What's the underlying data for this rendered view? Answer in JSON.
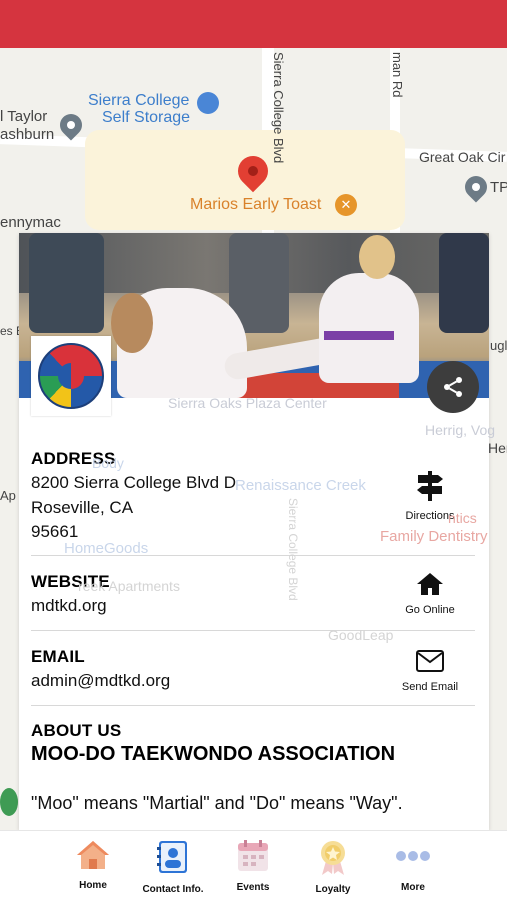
{
  "map": {
    "labels": {
      "taylor": "l Taylor",
      "ashburn": "ashburn",
      "storage_1": "Sierra College",
      "storage_2": "Self Storage",
      "sierra_blvd": "Sierra College Blvd",
      "oakman": "man Rd",
      "great_oak": "Great Oak Cir",
      "tp": "TP",
      "marios": "Marios Early Toast",
      "pennymac": "ennymac",
      "es": "es E",
      "ugl": "ugl",
      "oaks_plaza": "Sierra Oaks Plaza Center",
      "herrig": "Herrig, Vog",
      "hensley": "Hensley, L",
      "renaissance": "Renaissance Creek",
      "body": "Body",
      "ap": "Ap",
      "homegoods": "HomeGoods",
      "creek_apts": "reek Apartments",
      "family_dentistry_1": "ntics",
      "family_dentistry_2": "Family Dentistry",
      "sierra_blvd_2": "Sierra College Blvd",
      "goodleap": "GoodLeap"
    }
  },
  "card": {
    "address": {
      "title": "ADDRESS",
      "line1": "8200 Sierra College Blvd D",
      "line2": "Roseville, CA",
      "line3": "95661",
      "action_label": "Directions",
      "action_icon": "signpost-icon"
    },
    "website": {
      "title": "WEBSITE",
      "value": "mdtkd.org",
      "action_label": "Go Online",
      "action_icon": "home-icon"
    },
    "email": {
      "title": "EMAIL",
      "value": "admin@mdtkd.org",
      "action_label": "Send Email",
      "action_icon": "envelope-icon"
    },
    "about": {
      "title": "ABOUT US",
      "heading": "MOO-DO TAEKWONDO ASSOCIATION",
      "text": "\"Moo\" means \"Martial\" and \"Do\" means \"Way\"."
    }
  },
  "bottom_nav": [
    {
      "label": "Home",
      "icon": "house-icon"
    },
    {
      "label": "Contact Info.",
      "icon": "contact-book-icon"
    },
    {
      "label": "Events",
      "icon": "calendar-icon"
    },
    {
      "label": "Loyalty",
      "icon": "medal-icon"
    },
    {
      "label": "More",
      "icon": "more-dots-icon"
    }
  ],
  "colors": {
    "top_bar": "#d5343f",
    "map_pin": "#e23f33",
    "share_button": "#3d3d3d"
  }
}
